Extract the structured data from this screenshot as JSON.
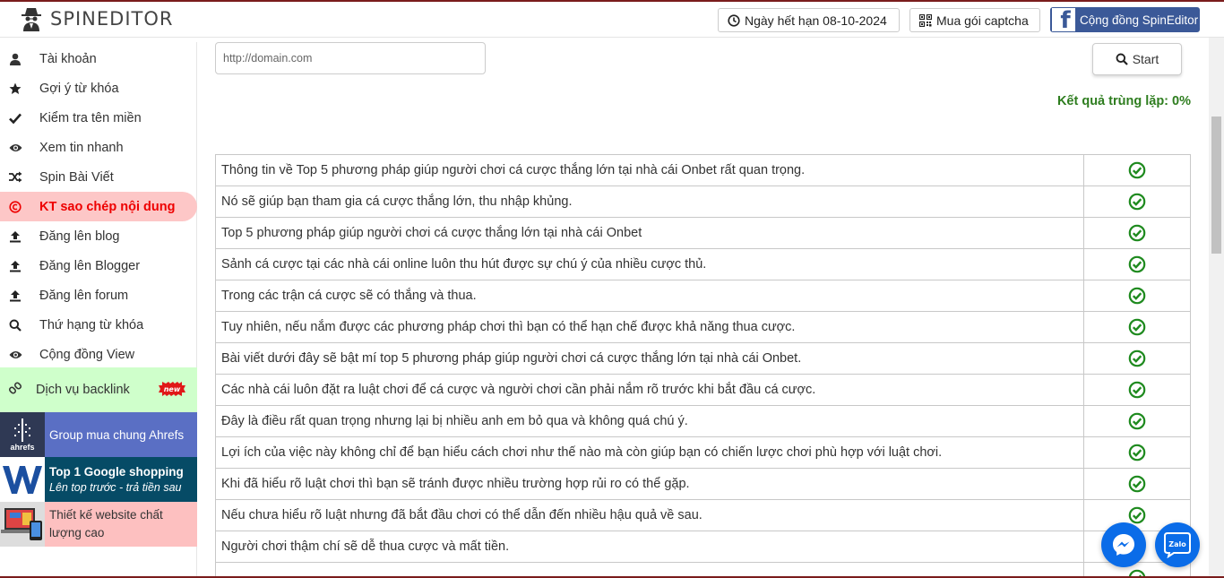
{
  "header": {
    "brand_name": "SPINEDITOR",
    "expire_label": "Ngày hết hạn 08-10-2024",
    "captcha_label": "Mua gói captcha",
    "community_label": "Cộng đồng SpinEditor"
  },
  "sidebar": {
    "items": [
      {
        "label": "Tài khoản",
        "icon": "user-icon"
      },
      {
        "label": "Gợi ý từ khóa",
        "icon": "star-icon"
      },
      {
        "label": "Kiểm tra tên miền",
        "icon": "check-icon"
      },
      {
        "label": "Xem tin nhanh",
        "icon": "eye-icon"
      },
      {
        "label": "Spin Bài Viết",
        "icon": "shuffle-icon"
      },
      {
        "label": "KT sao chép nội dung",
        "icon": "copyright-icon",
        "active": true
      },
      {
        "label": "Đăng lên blog",
        "icon": "upload-icon"
      },
      {
        "label": "Đăng lên Blogger",
        "icon": "upload-icon"
      },
      {
        "label": "Đăng lên forum",
        "icon": "upload-icon"
      },
      {
        "label": "Thứ hạng từ khóa",
        "icon": "search-icon"
      },
      {
        "label": "Cộng đồng View",
        "icon": "eye-icon"
      }
    ],
    "backlink_label": "Dịch vụ backlink",
    "new_badge": "new",
    "promos": [
      {
        "text": "Group mua chung Ahrefs",
        "logo_text": "ahrefs"
      },
      {
        "title": "Top 1 Google shopping",
        "subtitle": "Lên top trước - trả tiền sau"
      },
      {
        "text": "Thiết kế website chất lượng cao"
      }
    ]
  },
  "main": {
    "url_placeholder": "http://domain.com",
    "start_label": "Start",
    "duplicate_result": "Kết quả trùng lặp: 0%",
    "rows": [
      "Thông tin về Top 5 phương pháp giúp người chơi cá cược thắng lớn tại nhà cái Onbet rất quan trọng.",
      "Nó sẽ giúp bạn tham gia cá cược thắng lớn, thu nhập khủng.",
      "Top 5 phương pháp giúp người chơi cá cược thắng lớn tại nhà cái Onbet",
      "Sảnh cá cược tại các nhà cái online luôn thu hút được sự chú ý của nhiều cược thủ.",
      "Trong các trận cá cược sẽ có thắng và thua.",
      "Tuy nhiên, nếu nắm được các phương pháp chơi thì bạn có thể hạn chế được khả năng thua cược.",
      "Bài viết dưới đây sẽ bật mí top 5 phương pháp giúp người chơi cá cược thắng lớn tại nhà cái Onbet.",
      "Các nhà cái luôn đặt ra luật chơi để cá cược và người chơi cần phải nắm rõ trước khi bắt đầu cá cược.",
      "Đây là điều rất quan trọng nhưng lại bị nhiều anh em bỏ qua và không quá chú ý.",
      "Lợi ích của việc này không chỉ để bạn hiểu cách chơi như thế nào mà còn giúp bạn có chiến lược chơi phù hợp với luật chơi.",
      "Khi đã hiểu rõ luật chơi thì bạn sẽ tránh được nhiều trường hợp rủi ro có thể gặp.",
      "Nếu chưa hiểu rõ luật nhưng đã bắt đầu chơi có thể dẫn đến nhiều hậu quả về sau.",
      "Người chơi thậm chí sẽ dễ thua cược và mất tiền.",
      ""
    ]
  },
  "chat": {
    "zalo_label": "Zalo"
  },
  "colors": {
    "accent_green": "#2e7d1f",
    "active_red": "#e00000",
    "facebook_blue": "#3b5998",
    "messenger_blue": "#0a6ce8"
  }
}
